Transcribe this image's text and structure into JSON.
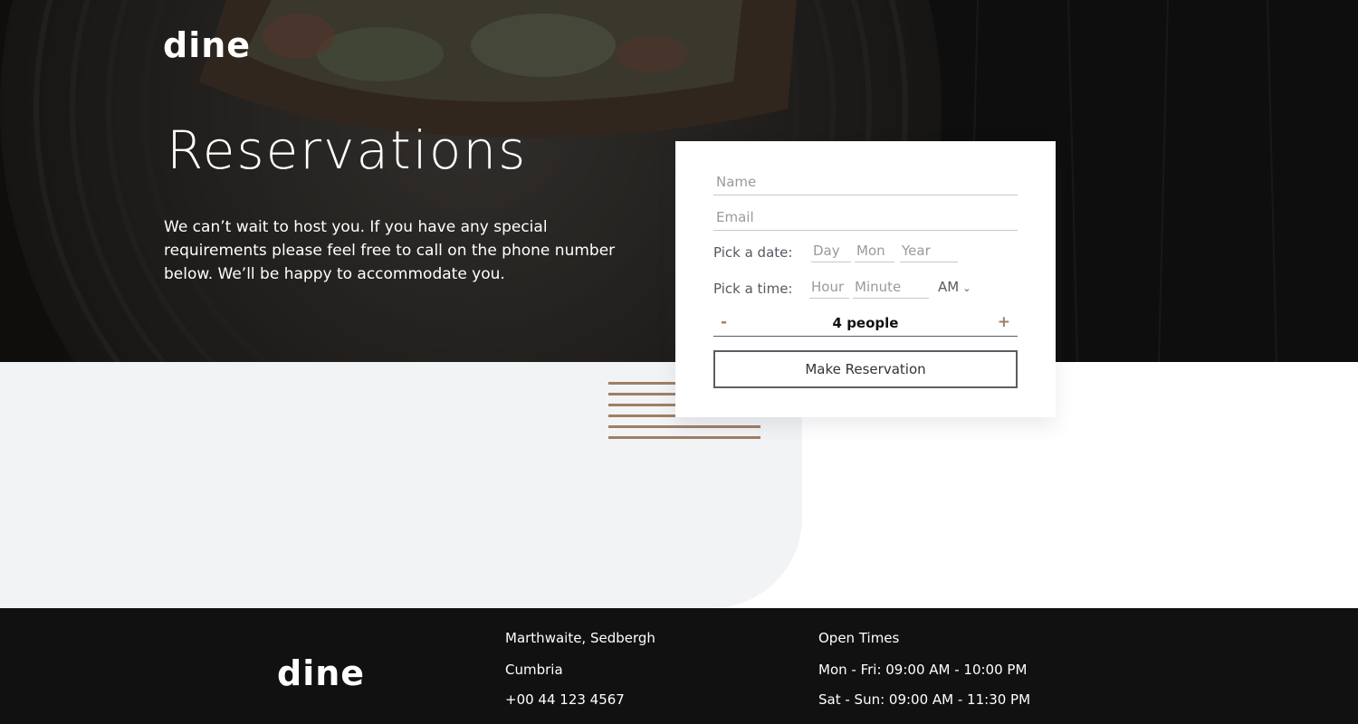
{
  "brand": {
    "logo": "dine"
  },
  "hero": {
    "title": "Reservations",
    "text": "We can’t wait to host you. If you have any special requirements please feel free to call on the phone number below. We’ll be happy to accommodate you."
  },
  "form": {
    "name_placeholder": "Name",
    "email_placeholder": "Email",
    "date_label": "Pick a date:",
    "day_placeholder": "Day",
    "month_placeholder": "Mon",
    "year_placeholder": "Year",
    "time_label": "Pick a time:",
    "hour_placeholder": "Hour",
    "minute_placeholder": "Minute",
    "ampm_value": "AM",
    "minus_label": "-",
    "plus_label": "+",
    "people_count": "4 people",
    "submit_label": "Make Reservation"
  },
  "footer": {
    "logo": "dine",
    "address_line1": "Marthwaite, Sedbergh",
    "address_line2": "Cumbria",
    "phone": "+00 44 123 4567",
    "hours_title": "Open Times",
    "hours_weekday": "Mon - Fri: 09:00 AM - 10:00 PM",
    "hours_weekend": "Sat - Sun: 09:00 AM - 11:30 PM"
  },
  "colors": {
    "accent": "#9e7f66",
    "footer_bg": "#111111",
    "panel_bg": "#f2f3f5"
  },
  "icons": {
    "ampm_toggle": "chevron-down-icon",
    "decoration": "stripes-pattern"
  }
}
